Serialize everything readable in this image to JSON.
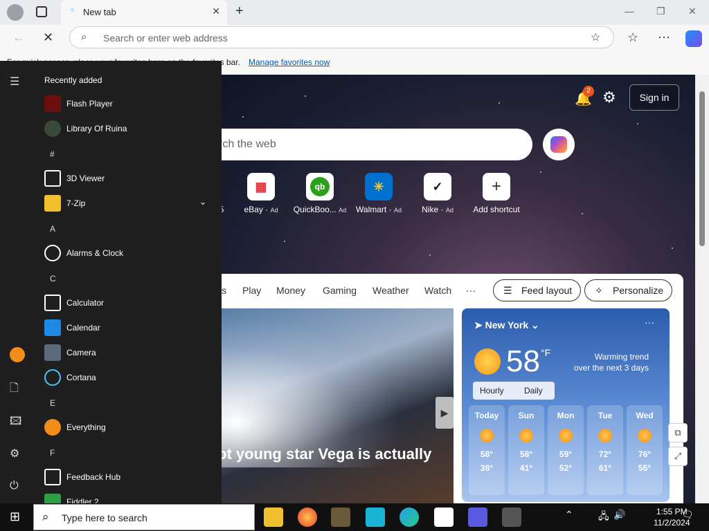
{
  "browser": {
    "tab_title": "New tab",
    "omnibox_placeholder": "Search or enter web address",
    "favorites_bar_text": "For quick access, place your favorites here on the favorites bar.",
    "favorites_bar_link": "Manage favorites now"
  },
  "newtab": {
    "sign_in": "Sign in",
    "notification_count": "2",
    "search_placeholder": "rch the web",
    "quick_links": [
      {
        "label": "5",
        "ad": ""
      },
      {
        "label": "eBay",
        "ad": "Ad"
      },
      {
        "label": "QuickBoo...",
        "ad": "Ad"
      },
      {
        "label": "Walmart",
        "ad": "Ad"
      },
      {
        "label": "Nike",
        "ad": "Ad"
      },
      {
        "label": "Add shortcut",
        "ad": ""
      }
    ],
    "feed_tabs": [
      "s",
      "Play",
      "Money",
      "Gaming",
      "Weather",
      "Watch",
      "···"
    ],
    "feed_layout": "Feed layout",
    "personalize": "Personalize",
    "hero_headline": "ot young star Vega is actually"
  },
  "weather": {
    "location": "New York",
    "temp": "58",
    "unit": "°F",
    "trend_line1": "Warming trend",
    "trend_line2": "over the next 3 days",
    "tab_hourly": "Hourly",
    "tab_daily": "Daily",
    "days": [
      {
        "name": "Today",
        "hi": "58°",
        "lo": "38°"
      },
      {
        "name": "Sun",
        "hi": "58°",
        "lo": "41°"
      },
      {
        "name": "Mon",
        "hi": "59°",
        "lo": "52°"
      },
      {
        "name": "Tue",
        "hi": "72°",
        "lo": "61°"
      },
      {
        "name": "Wed",
        "hi": "76°",
        "lo": "55°"
      }
    ]
  },
  "start_menu": {
    "recently_added": "Recently added",
    "items": [
      {
        "type": "app",
        "label": "Flash Player",
        "color": "#6b0f0f"
      },
      {
        "type": "app",
        "label": "Library Of Ruina",
        "color": "#3a4a3a"
      },
      {
        "type": "header",
        "label": "#"
      },
      {
        "type": "app",
        "label": "3D Viewer",
        "color": "#1f1f1f"
      },
      {
        "type": "app",
        "label": "7-Zip",
        "color": "#f2c02f"
      },
      {
        "type": "header",
        "label": "A"
      },
      {
        "type": "app",
        "label": "Alarms & Clock",
        "color": "#1f1f1f"
      },
      {
        "type": "header",
        "label": "C"
      },
      {
        "type": "app",
        "label": "Calculator",
        "color": "#1f1f1f"
      },
      {
        "type": "app",
        "label": "Calendar",
        "color": "#1e88e5"
      },
      {
        "type": "app",
        "label": "Camera",
        "color": "#5a6a7a"
      },
      {
        "type": "app",
        "label": "Cortana",
        "color": "#1f1f1f"
      },
      {
        "type": "header",
        "label": "E"
      },
      {
        "type": "app",
        "label": "Everything",
        "color": "#f28c1b"
      },
      {
        "type": "header",
        "label": "F"
      },
      {
        "type": "app",
        "label": "Feedback Hub",
        "color": "#1f1f1f"
      },
      {
        "type": "app",
        "label": "Fiddler 2",
        "color": "#2e9e45"
      }
    ]
  },
  "taskbar": {
    "search_placeholder": "Type here to search",
    "time": "1:55 PM",
    "date": "11/2/2024"
  }
}
